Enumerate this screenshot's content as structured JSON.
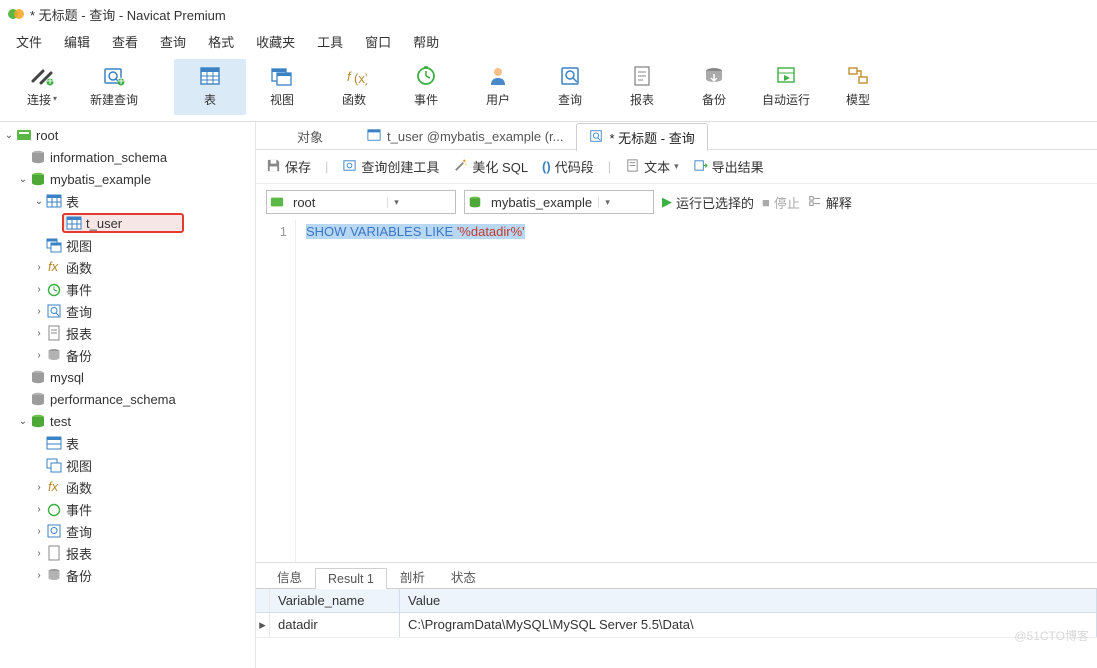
{
  "window": {
    "title": "* 无标题 - 查询 - Navicat Premium"
  },
  "menus": [
    "文件",
    "编辑",
    "查看",
    "查询",
    "格式",
    "收藏夹",
    "工具",
    "窗口",
    "帮助"
  ],
  "toolbar": [
    {
      "id": "connect",
      "label": "连接",
      "caret": true
    },
    {
      "id": "newquery",
      "label": "新建查询"
    },
    {
      "id": "tables",
      "label": "表",
      "active": true
    },
    {
      "id": "views",
      "label": "视图"
    },
    {
      "id": "functions",
      "label": "函数"
    },
    {
      "id": "events",
      "label": "事件"
    },
    {
      "id": "users",
      "label": "用户"
    },
    {
      "id": "queries",
      "label": "查询"
    },
    {
      "id": "reports",
      "label": "报表"
    },
    {
      "id": "backup",
      "label": "备份"
    },
    {
      "id": "autorun",
      "label": "自动运行"
    },
    {
      "id": "model",
      "label": "模型"
    }
  ],
  "tree": {
    "root": {
      "label": "root",
      "open": true
    },
    "dbs": [
      {
        "id": "information_schema",
        "label": "information_schema",
        "open": false,
        "active": false
      },
      {
        "id": "mybatis_example",
        "label": "mybatis_example",
        "open": true,
        "active": true,
        "children": [
          {
            "id": "tables",
            "label": "表",
            "icon": "table",
            "open": true,
            "children": [
              {
                "id": "t_user",
                "label": "t_user",
                "icon": "table",
                "highlight": true
              }
            ]
          },
          {
            "id": "views",
            "label": "视图",
            "icon": "view"
          },
          {
            "id": "functions",
            "label": "函数",
            "icon": "fx",
            "expander": true
          },
          {
            "id": "events",
            "label": "事件",
            "icon": "event",
            "expander": true
          },
          {
            "id": "queries",
            "label": "查询",
            "icon": "query",
            "expander": true
          },
          {
            "id": "reports",
            "label": "报表",
            "icon": "report",
            "expander": true
          },
          {
            "id": "backup",
            "label": "备份",
            "icon": "backup",
            "expander": true
          }
        ]
      },
      {
        "id": "mysql",
        "label": "mysql",
        "open": false,
        "active": false
      },
      {
        "id": "performance_schema",
        "label": "performance_schema",
        "open": false,
        "active": false
      },
      {
        "id": "test",
        "label": "test",
        "open": true,
        "active": true,
        "children": [
          {
            "id": "tables2",
            "label": "表",
            "icon": "table"
          },
          {
            "id": "views2",
            "label": "视图",
            "icon": "view"
          },
          {
            "id": "functions2",
            "label": "函数",
            "icon": "fx",
            "expander": true
          },
          {
            "id": "events2",
            "label": "事件",
            "icon": "event",
            "expander": true
          },
          {
            "id": "queries2",
            "label": "查询",
            "icon": "query",
            "expander": true
          },
          {
            "id": "reports2",
            "label": "报表",
            "icon": "report",
            "expander": true
          },
          {
            "id": "backup2",
            "label": "备份",
            "icon": "backup",
            "expander": true
          }
        ]
      }
    ]
  },
  "tabs": {
    "objects": "对象",
    "tableTab": "t_user @mybatis_example (r...",
    "queryTab": "* 无标题 - 查询"
  },
  "queryBar": {
    "save": "保存",
    "builder": "查询创建工具",
    "beautify": "美化 SQL",
    "snippet": "代码段",
    "text": "文本",
    "export": "导出结果"
  },
  "conn": {
    "connection": "root",
    "database": "mybatis_example",
    "run": "运行已选择的",
    "stop": "停止",
    "explain": "解释"
  },
  "editor": {
    "lineNo": "1",
    "kw1": "SHOW",
    "kw2": "VARIABLES",
    "kw3": "LIKE",
    "str": "'%datadir%'"
  },
  "resultTabs": [
    "信息",
    "Result 1",
    "剖析",
    "状态"
  ],
  "resultActive": 1,
  "grid": {
    "cols": [
      "Variable_name",
      "Value"
    ],
    "row": {
      "name": "datadir",
      "value": "C:\\ProgramData\\MySQL\\MySQL Server 5.5\\Data\\"
    }
  },
  "watermark": "@51CTO博客"
}
